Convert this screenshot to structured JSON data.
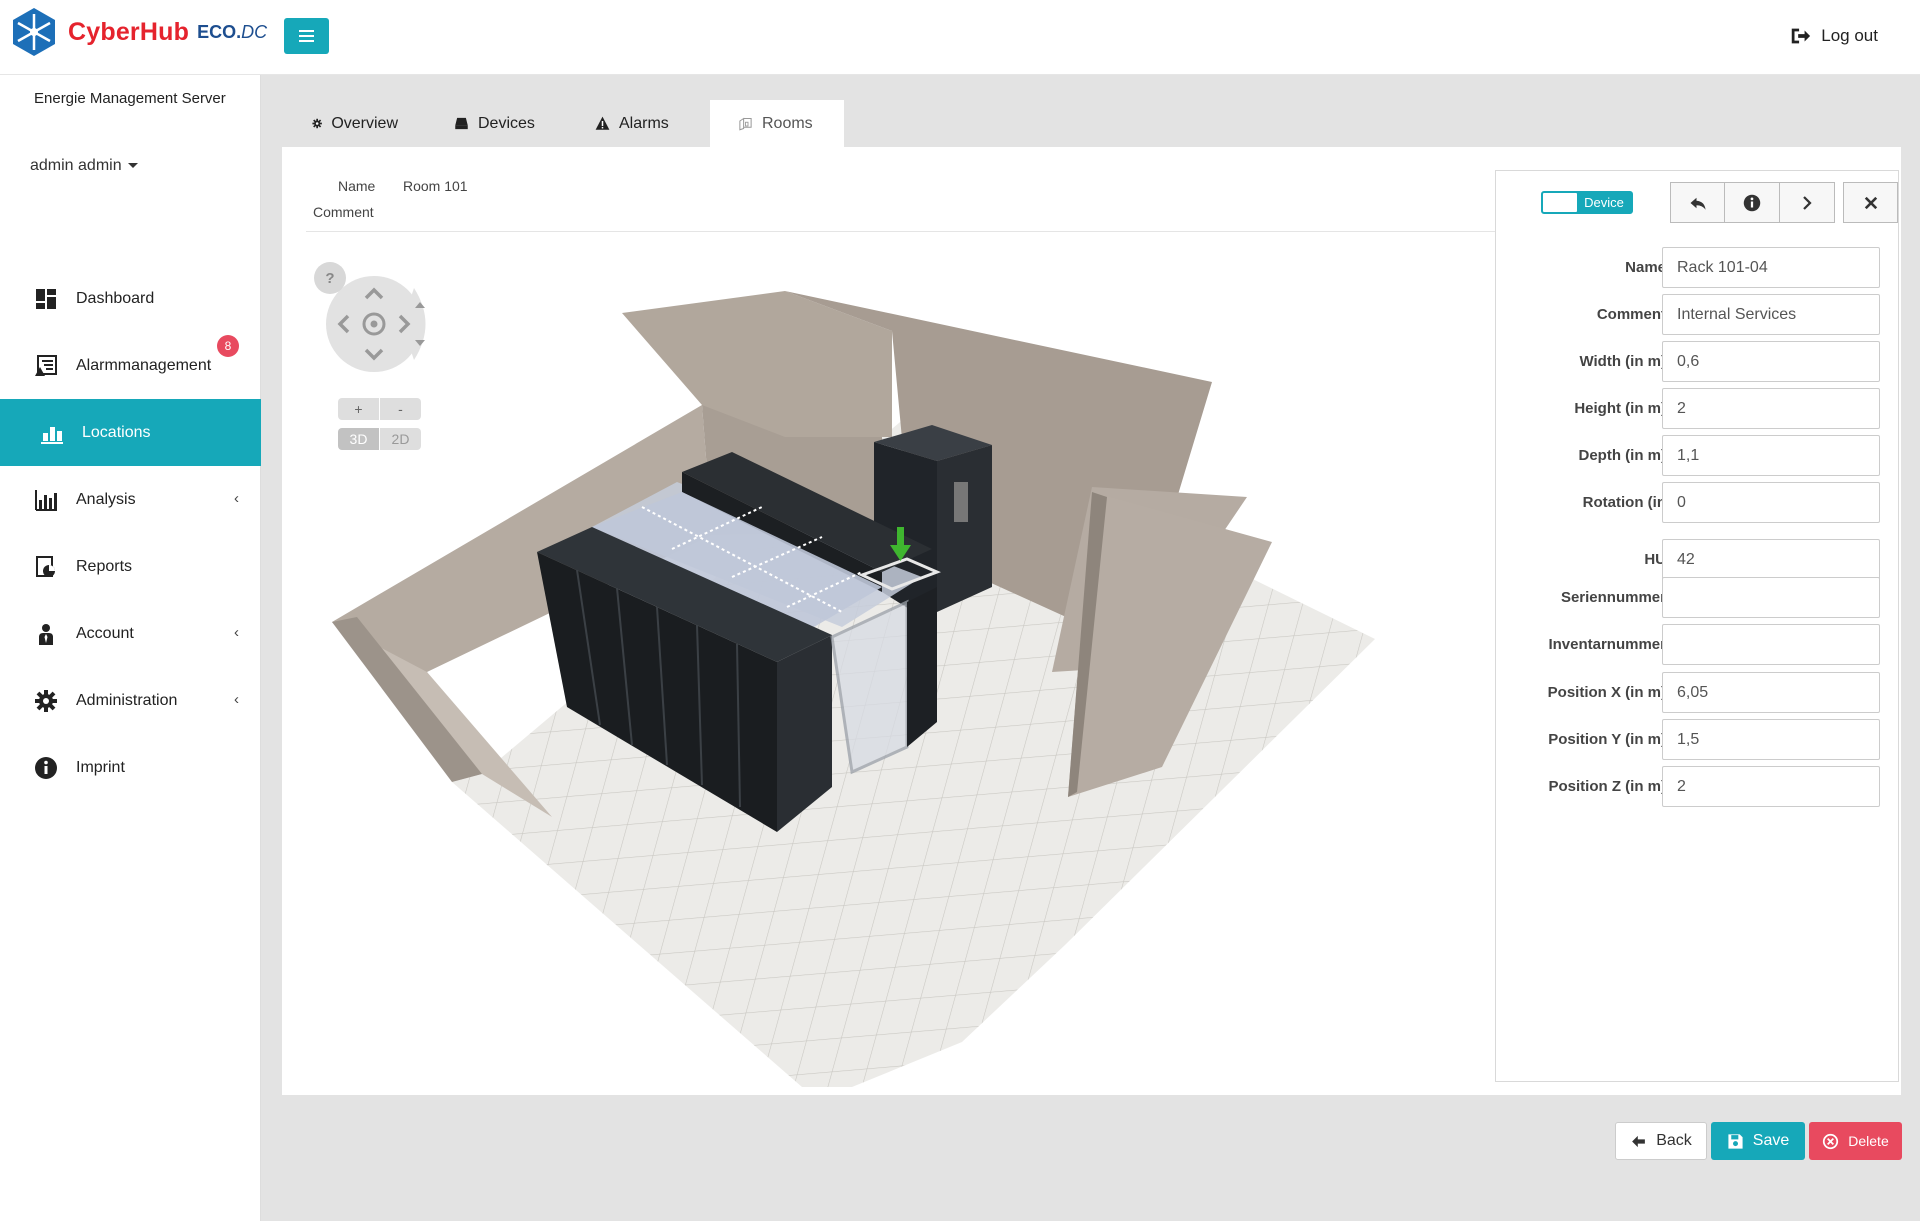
{
  "app": {
    "brand": "CyberHub",
    "brand_suffix_1": "ECO.",
    "brand_suffix_2": "DC",
    "logout_label": "Log out"
  },
  "sidebar": {
    "server_name": "Energie Management Server",
    "user": "admin admin",
    "items": [
      {
        "label": "Dashboard",
        "icon": "dashboard-icon"
      },
      {
        "label": "Alarmmanagement",
        "icon": "alarm-list-icon",
        "badge": "8"
      },
      {
        "label": "Locations",
        "icon": "locations-icon",
        "active": true
      },
      {
        "label": "Analysis",
        "icon": "bar-chart-icon",
        "expandable": true
      },
      {
        "label": "Reports",
        "icon": "reports-icon"
      },
      {
        "label": "Account",
        "icon": "user-tie-icon",
        "expandable": true
      },
      {
        "label": "Administration",
        "icon": "gear-icon",
        "expandable": true
      },
      {
        "label": "Imprint",
        "icon": "info-icon"
      }
    ]
  },
  "tabs": [
    {
      "label": "Overview",
      "icon": "gear-icon"
    },
    {
      "label": "Devices",
      "icon": "hdd-icon"
    },
    {
      "label": "Alarms",
      "icon": "warning-icon"
    },
    {
      "label": "Rooms",
      "icon": "room-icon",
      "active": true
    }
  ],
  "room": {
    "name_label": "Name",
    "name_value": "Room 101",
    "comment_label": "Comment"
  },
  "viewer": {
    "help": "?",
    "zoom_in": "+",
    "zoom_out": "-",
    "mode_3d": "3D",
    "mode_2d": "2D",
    "active_mode": "3D"
  },
  "properties": {
    "toggle_label": "Device",
    "fields": [
      {
        "label": "Name",
        "value": "Rack 101-04"
      },
      {
        "label": "Comment",
        "value": "Internal Services"
      },
      {
        "label": "Width (in m)",
        "value": "0,6"
      },
      {
        "label": "Height (in m)",
        "value": "2"
      },
      {
        "label": "Depth (in m)",
        "value": "1,1"
      },
      {
        "label": "Rotation (in",
        "value": "0"
      },
      {
        "label": "HU",
        "value": "42"
      },
      {
        "label": "Seriennummer",
        "value": ""
      },
      {
        "label": "Inventarnummer",
        "value": ""
      },
      {
        "label": "Position X (in m)",
        "value": "6,05"
      },
      {
        "label": "Position Y (in m)",
        "value": "1,5"
      },
      {
        "label": "Position Z (in m)",
        "value": "2"
      }
    ]
  },
  "actions": {
    "back": "Back",
    "save": "Save",
    "delete": "Delete"
  },
  "colors": {
    "accent": "#16a8b9",
    "danger": "#e84a5f",
    "brand_red": "#e5232d",
    "brand_blue": "#1d4e8f"
  }
}
